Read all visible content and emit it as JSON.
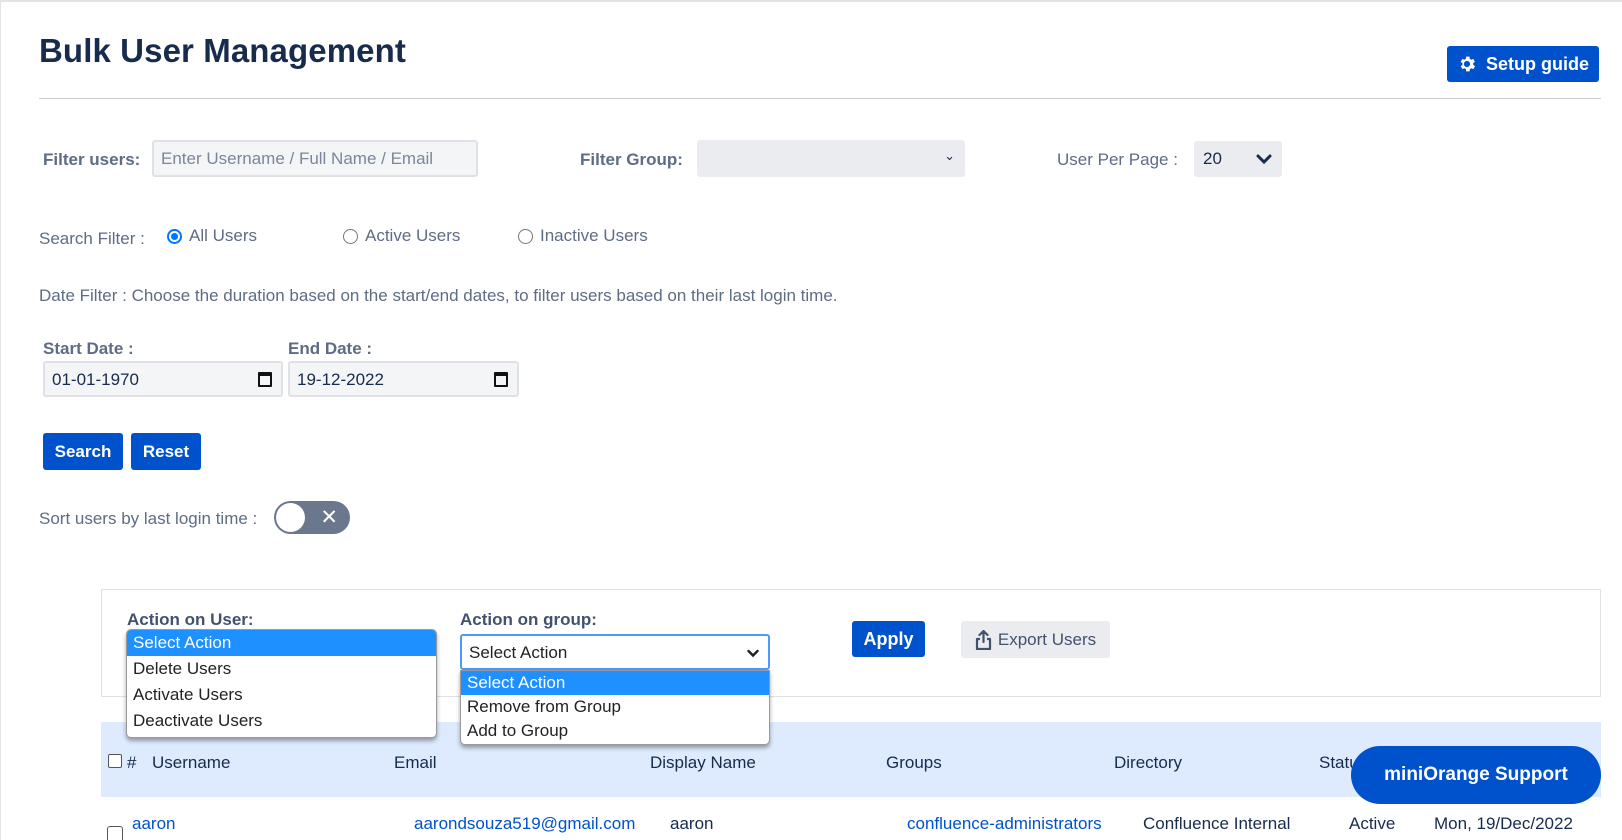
{
  "header": {
    "title": "Bulk User Management",
    "setup_guide_label": "Setup guide",
    "setup_guide_icon": "gear-icon"
  },
  "filters": {
    "filter_users_label": "Filter users:",
    "filter_users_placeholder": "Enter Username / Full Name / Email",
    "filter_users_value": "",
    "filter_group_label": "Filter Group:",
    "filter_group_value": "",
    "user_per_page_label": "User Per Page :",
    "user_per_page_value": "20",
    "search_filter_label": "Search Filter :",
    "search_filter_options": [
      {
        "label": "All Users",
        "checked": true
      },
      {
        "label": "Active Users",
        "checked": false
      },
      {
        "label": "Inactive Users",
        "checked": false
      }
    ],
    "date_filter_note": "Date Filter : Choose the duration based on the start/end dates, to filter users based on their last login time.",
    "start_date_label": "Start Date :",
    "start_date_value": "01-01-1970",
    "end_date_label": "End Date :",
    "end_date_value": "19-12-2022",
    "search_label": "Search",
    "reset_label": "Reset",
    "sort_label": "Sort users by last login time :",
    "sort_toggle_on": false
  },
  "actions": {
    "action_on_user_label": "Action on User:",
    "action_on_user_options": [
      "Select Action",
      "Delete Users",
      "Activate Users",
      "Deactivate Users"
    ],
    "action_on_user_selected": "Select Action",
    "action_on_group_label": "Action on group:",
    "action_on_group_value": "Select Action",
    "action_on_group_options": [
      "Select Action",
      "Remove from Group",
      "Add to Group"
    ],
    "apply_label": "Apply",
    "export_label": "Export Users",
    "export_icon": "share-upload-icon"
  },
  "table": {
    "columns": [
      "#",
      "Username",
      "Email",
      "Display Name",
      "Groups",
      "Directory",
      "Status"
    ],
    "rows": [
      {
        "username": "aaron",
        "email": "aarondsouza519@gmail.com",
        "display_name": "aaron",
        "groups": "confluence-administrators",
        "directory": "Confluence Internal",
        "status": "Active",
        "last_login": "Mon, 19/Dec/2022"
      }
    ]
  },
  "support": {
    "label": "miniOrange Support"
  },
  "colors": {
    "primary": "#0052cc",
    "title": "#172b4d",
    "label": "#5e6c84",
    "table_header_bg": "#deebff",
    "option_highlight": "#1e90ff"
  }
}
